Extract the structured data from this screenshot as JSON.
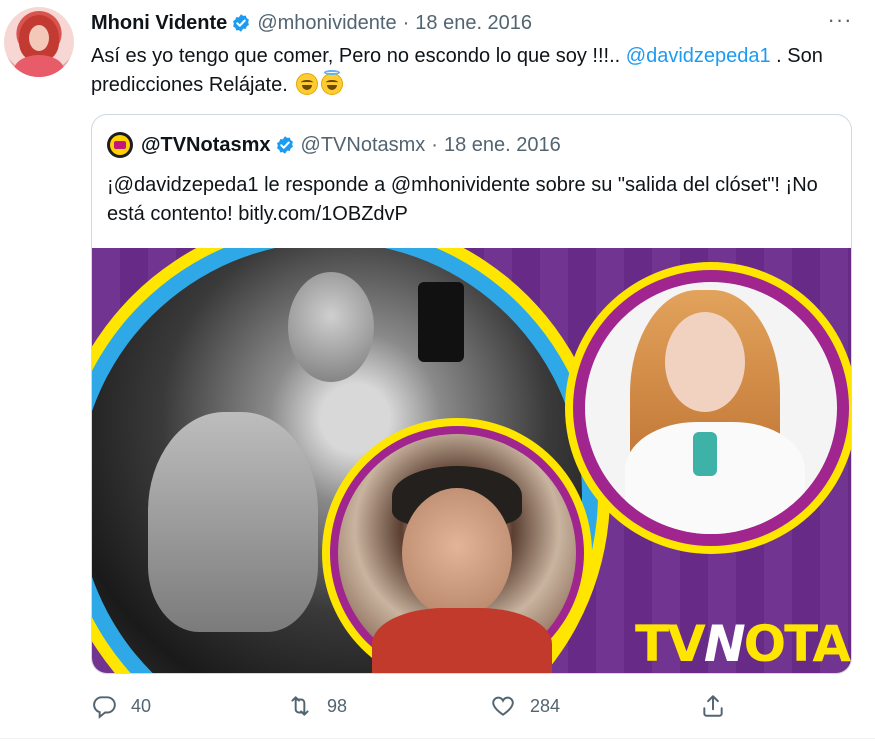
{
  "tweet": {
    "author": {
      "display_name": "Mhoni Vidente",
      "handle": "@mhonividente",
      "date": "18 ene. 2016",
      "verified": true
    },
    "text_parts": [
      "Así es yo tengo que comer,  Pero no escondo lo que soy !!!.. ",
      "@davidzepeda1",
      " . Son predicciones Relájate. "
    ],
    "emojis": [
      "grinning-squinting-face",
      "smiling-face-with-halo"
    ],
    "more_icon": "more-horizontal-icon"
  },
  "quoted": {
    "display_name": "@TVNotasmx",
    "handle": "@TVNotasmx",
    "date": "18 ene. 2016",
    "verified": true,
    "text": "¡@davidzepeda1 le responde a @mhonividente sobre su \"salida del clóset\"! ¡No está contento! bitly.com/1OBZdvP",
    "media": {
      "brand_prefix": "TV",
      "brand_n": "N",
      "brand_suffix": "OTAS",
      "colors": {
        "purple": "#6b2c8c",
        "yellow": "#ffe600",
        "blue": "#2ea8e6",
        "magenta": "#a0258e"
      }
    }
  },
  "actions": {
    "reply": {
      "icon": "reply-icon",
      "count": "40"
    },
    "retweet": {
      "icon": "retweet-icon",
      "count": "98"
    },
    "like": {
      "icon": "heart-icon",
      "count": "284"
    },
    "share": {
      "icon": "share-icon"
    }
  },
  "colors": {
    "accent": "#1d9bf0",
    "secondary_text": "#536471",
    "border": "#cfd9de"
  }
}
